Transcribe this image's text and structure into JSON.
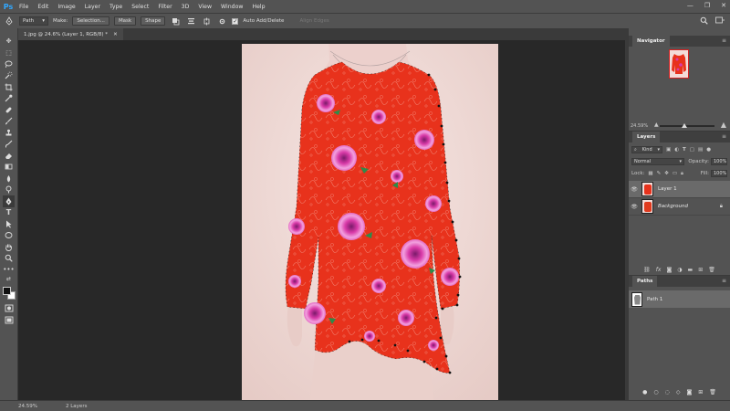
{
  "app": {
    "logo": "Ps"
  },
  "menu": [
    "File",
    "Edit",
    "Image",
    "Layer",
    "Type",
    "Select",
    "Filter",
    "3D",
    "View",
    "Window",
    "Help"
  ],
  "window_controls": {
    "minimize": "—",
    "maximize": "❐",
    "close": "✕"
  },
  "options": {
    "mode_value": "Path",
    "make_label": "Make:",
    "selection_btn": "Selection...",
    "mask_btn": "Mask",
    "shape_btn": "Shape",
    "auto_add_delete": "Auto Add/Delete",
    "align_edges": "Align Edges"
  },
  "document_tab": {
    "title": "1.jpg @ 24.6% (Layer 1, RGB/8) *",
    "close": "✕"
  },
  "status": {
    "zoom": "24.59%",
    "info": "2 Layers"
  },
  "navigator": {
    "title": "Navigator",
    "zoom": "24.59%"
  },
  "layers": {
    "title": "Layers",
    "kind_label": "Kind",
    "blend_mode": "Normal",
    "opacity_label": "Opacity:",
    "opacity_value": "100%",
    "lock_label": "Lock:",
    "fill_label": "Fill:",
    "fill_value": "100%",
    "items": [
      {
        "name": "Layer 1"
      },
      {
        "name": "Background"
      }
    ]
  },
  "paths": {
    "title": "Paths",
    "items": [
      {
        "name": "Path 1"
      }
    ]
  },
  "colors": {
    "shirt": "#e8321c",
    "flower": "#e040b8",
    "leaf": "#2e8a4a",
    "background": "#f0dcd8",
    "mannequin": "#ecd4d0"
  }
}
